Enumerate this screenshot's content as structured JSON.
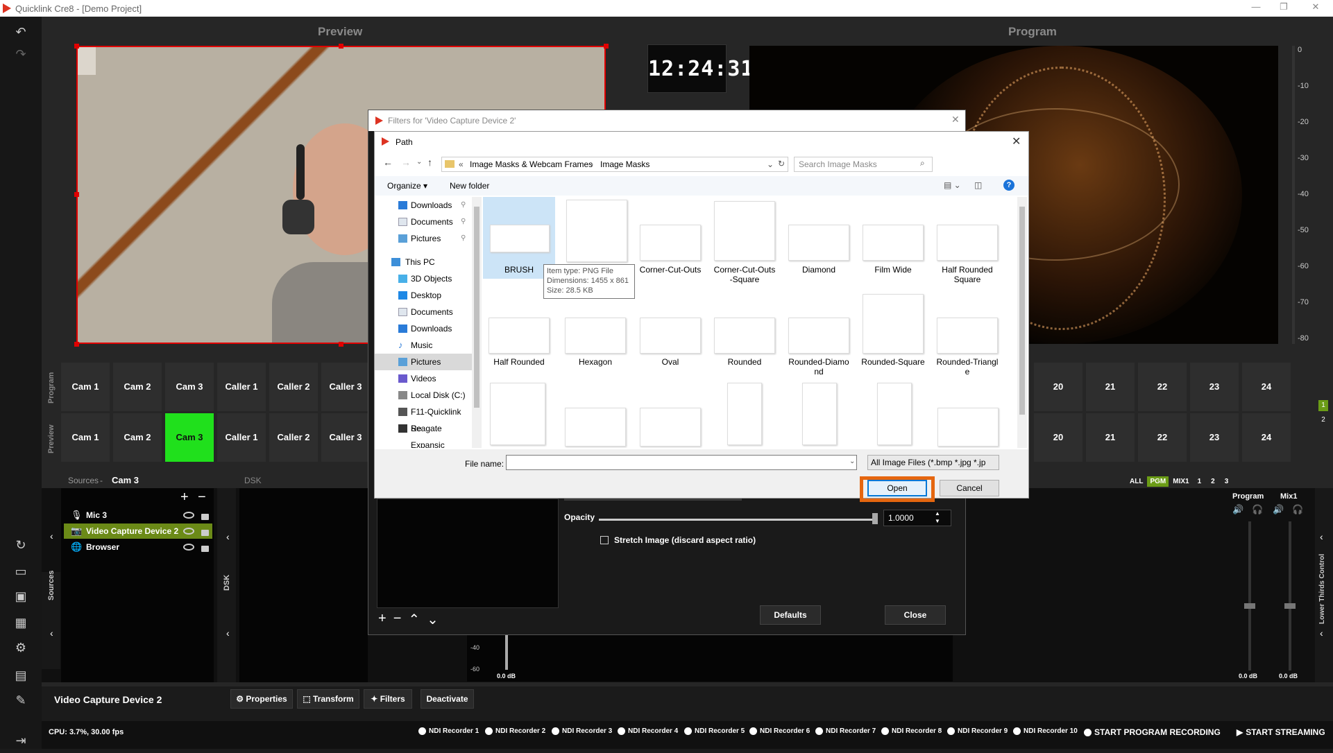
{
  "app": {
    "title": "Quicklink Cre8 - [Demo Project]"
  },
  "headers": {
    "preview": "Preview",
    "program": "Program"
  },
  "clock": "12:24:31",
  "vu": {
    "ticks": [
      "0",
      "-10",
      "-20",
      "-30",
      "-40",
      "-50",
      "-60",
      "-70",
      "-80"
    ]
  },
  "buses": {
    "program_label": "Program",
    "preview_label": "Preview",
    "left": [
      "Cam 1",
      "Cam 2",
      "Cam 3",
      "Caller 1",
      "Caller 2",
      "Caller 3"
    ],
    "right": [
      "20",
      "21",
      "22",
      "23",
      "24"
    ],
    "active_preview": "Cam 3",
    "side_indicators": [
      "1",
      "2"
    ]
  },
  "sources": {
    "header_label": "Sources",
    "current": "Cam 3",
    "dsk": "DSK",
    "side_label": "Sources",
    "dsk_side": "DSK",
    "items": [
      {
        "label": "Mic 3",
        "icon": "mic-icon"
      },
      {
        "label": "Video Capture Device 2",
        "icon": "camera-icon"
      },
      {
        "label": "Browser",
        "icon": "globe-icon"
      }
    ]
  },
  "mix": {
    "tabs": [
      "ALL",
      "PGM",
      "MIX1",
      "1",
      "2",
      "3"
    ],
    "channels": [
      "Program",
      "Mix1"
    ],
    "db": [
      "0.0 dB",
      "0.0 dB"
    ],
    "side_label": "Lower Thirds Control"
  },
  "filters_dialog": {
    "title": "Filters for 'Video Capture Device 2'",
    "opacity_label": "Opacity",
    "opacity_value": "1.0000",
    "stretch_label": "Stretch Image (discard aspect ratio)",
    "defaults": "Defaults",
    "close": "Close",
    "meter": [
      "-40",
      "-60",
      "0.0 dB"
    ]
  },
  "path_dialog": {
    "title": "Path",
    "breadcrumb": [
      "Image Masks & Webcam Frames",
      "Image Masks"
    ],
    "search_placeholder": "Search Image Masks",
    "organize": "Organize ▾",
    "new_folder": "New folder",
    "nav": [
      {
        "label": "Downloads",
        "icon": "download-icon",
        "pin": true
      },
      {
        "label": "Documents",
        "icon": "document-icon",
        "pin": true
      },
      {
        "label": "Pictures",
        "icon": "pictures-icon",
        "pin": true
      },
      {
        "label": "This PC",
        "icon": "computer-icon"
      },
      {
        "label": "3D Objects",
        "icon": "cube-icon"
      },
      {
        "label": "Desktop",
        "icon": "desktop-icon"
      },
      {
        "label": "Documents",
        "icon": "document-icon"
      },
      {
        "label": "Downloads",
        "icon": "download-icon"
      },
      {
        "label": "Music",
        "icon": "music-icon"
      },
      {
        "label": "Pictures",
        "icon": "pictures-icon"
      },
      {
        "label": "Videos",
        "icon": "video-icon"
      },
      {
        "label": "Local Disk (C:)",
        "icon": "disk-icon"
      },
      {
        "label": "F11-Quicklink Re",
        "icon": "drive-icon"
      },
      {
        "label": "Seagate Expansic",
        "icon": "drive-icon"
      }
    ],
    "files": [
      "BRUSH",
      "",
      "Corner-Cut-Outs",
      "Corner-Cut-Outs\n-Square",
      "Diamond",
      "Film Wide",
      "Half Rounded\nSquare",
      "Half Rounded",
      "Hexagon",
      "Oval",
      "Rounded",
      "Rounded-Diamo\nnd",
      "Rounded-Square",
      "Rounded-Triangl\ne"
    ],
    "tooltip": [
      "Item type: PNG File",
      "Dimensions: 1455 x 861",
      "Size: 28.5 KB"
    ],
    "filename_label": "File name:",
    "filename_value": "",
    "filetype": "All Image Files (*.bmp *.jpg *.jp",
    "open": "Open",
    "cancel": "Cancel"
  },
  "bottom": {
    "source_name": "Video Capture Device 2",
    "buttons": [
      "Properties",
      "Transform",
      "Filters",
      "Deactivate"
    ]
  },
  "status": {
    "cpu": "CPU: 3.7%, 30.00 fps",
    "recorders": [
      "NDI Recorder 1",
      "NDI Recorder 2",
      "NDI Recorder 3",
      "NDI Recorder 4",
      "NDI Recorder 5",
      "NDI Recorder 6",
      "NDI Recorder 7",
      "NDI Recorder 8",
      "NDI Recorder 9",
      "NDI Recorder 10"
    ],
    "program_recording": "START PROGRAM RECORDING",
    "streaming": "START STREAMING"
  },
  "colors": {
    "accent_green": "#20e01c",
    "preview_red": "#e10000",
    "highlight_orange": "#e5660f"
  }
}
